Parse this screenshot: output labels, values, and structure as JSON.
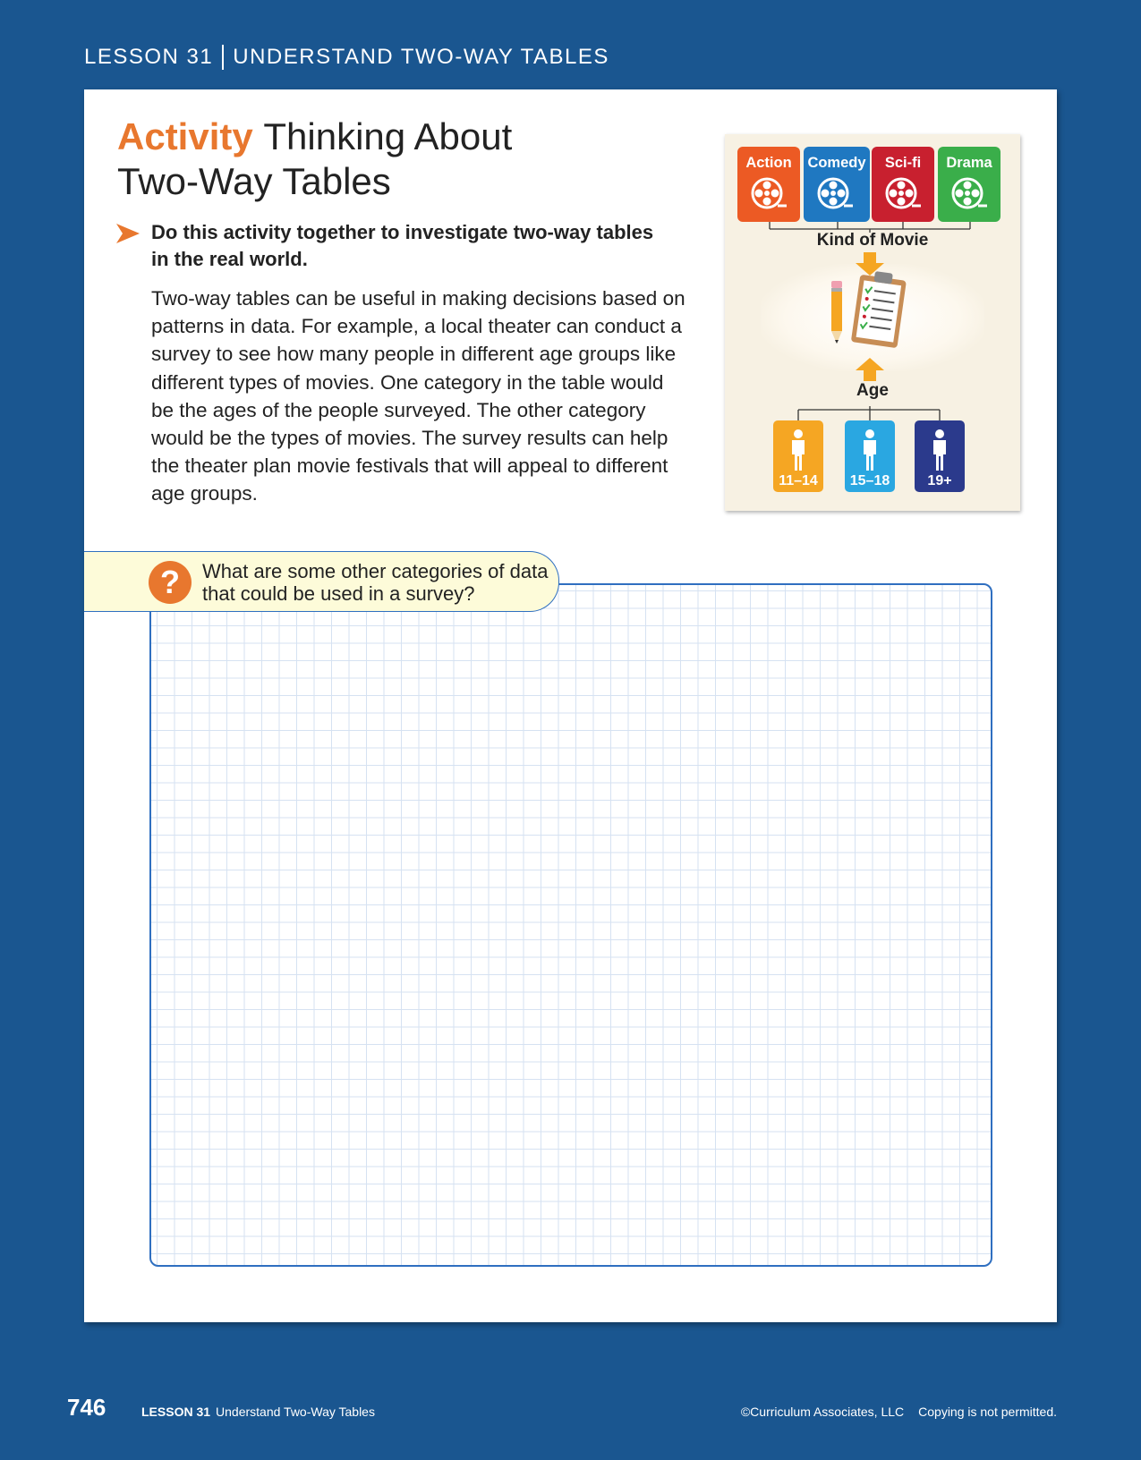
{
  "header": {
    "lesson": "LESSON 31",
    "topic": "UNDERSTAND TWO-WAY TABLES"
  },
  "activity": {
    "label": "Activity",
    "title_line1": "Thinking About",
    "title_line2": "Two-Way Tables",
    "instruction": "Do this activity together to investigate two-way tables in the real world.",
    "body": "Two-way tables can be useful in making decisions based on patterns in data. For example, a local theater can conduct a survey to see how many people in different age groups like different types of movies. One category in the table would be the ages of the people surveyed. The other category would be the types of movies. The survey results can help the theater plan movie festivals that will appeal to different age groups."
  },
  "illustration": {
    "genres": [
      {
        "label": "Action",
        "color": "#ec5a24"
      },
      {
        "label": "Comedy",
        "color": "#1f78c1"
      },
      {
        "label": "Sci-fi",
        "color": "#c8202f"
      },
      {
        "label": "Drama",
        "color": "#3aae4a"
      }
    ],
    "genre_group_label": "Kind of Movie",
    "age_group_label": "Age",
    "ages": [
      {
        "label": "11–14",
        "color": "#f5a623"
      },
      {
        "label": "15–18",
        "color": "#2aa7e1"
      },
      {
        "label": "19+",
        "color": "#2b3a8c"
      }
    ],
    "icons": [
      "film-reel-icon",
      "clipboard-checklist-icon",
      "pencil-icon",
      "person-icon",
      "arrow-down-icon",
      "arrow-up-icon"
    ]
  },
  "question": {
    "icon": "question-mark-icon",
    "text": "What are some other categories of data that could be used in a survey?"
  },
  "footer": {
    "page_number": "746",
    "lesson": "LESSON 31",
    "lesson_title": "Understand Two-Way Tables",
    "copyright": "©Curriculum Associates, LLC",
    "notice": "Copying is not permitted."
  }
}
